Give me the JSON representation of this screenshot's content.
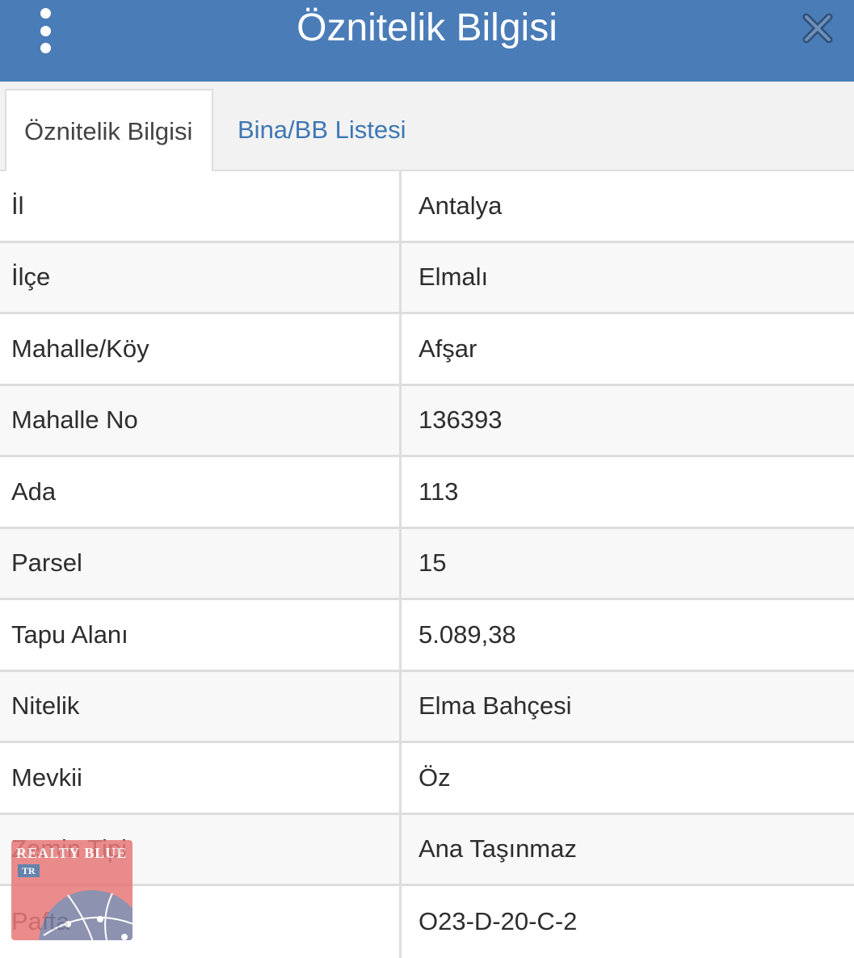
{
  "header": {
    "title": "Öznitelik Bilgisi",
    "menu_icon": "vertical-dots-icon",
    "close_icon": "close-x-icon",
    "background_color": "#4a7cb7"
  },
  "tabs": [
    {
      "label": "Öznitelik Bilgisi",
      "active": true
    },
    {
      "label": "Bina/BB Listesi",
      "active": false
    }
  ],
  "rows": [
    {
      "label": "İl",
      "value": "Antalya"
    },
    {
      "label": "İlçe",
      "value": "Elmalı"
    },
    {
      "label": "Mahalle/Köy",
      "value": "Afşar"
    },
    {
      "label": "Mahalle No",
      "value": "136393"
    },
    {
      "label": "Ada",
      "value": "113"
    },
    {
      "label": "Parsel",
      "value": "15"
    },
    {
      "label": "Tapu Alanı",
      "value": "5.089,38"
    },
    {
      "label": "Nitelik",
      "value": "Elma Bahçesi"
    },
    {
      "label": "Mevkii",
      "value": "Öz"
    },
    {
      "label": "Zemin Tipi",
      "value": "Ana Taşınmaz"
    },
    {
      "label": "Pafta",
      "value": "O23-D-20-C-2"
    }
  ],
  "watermark_logo": {
    "text": "REALTY BLUE",
    "badge": "TR"
  }
}
